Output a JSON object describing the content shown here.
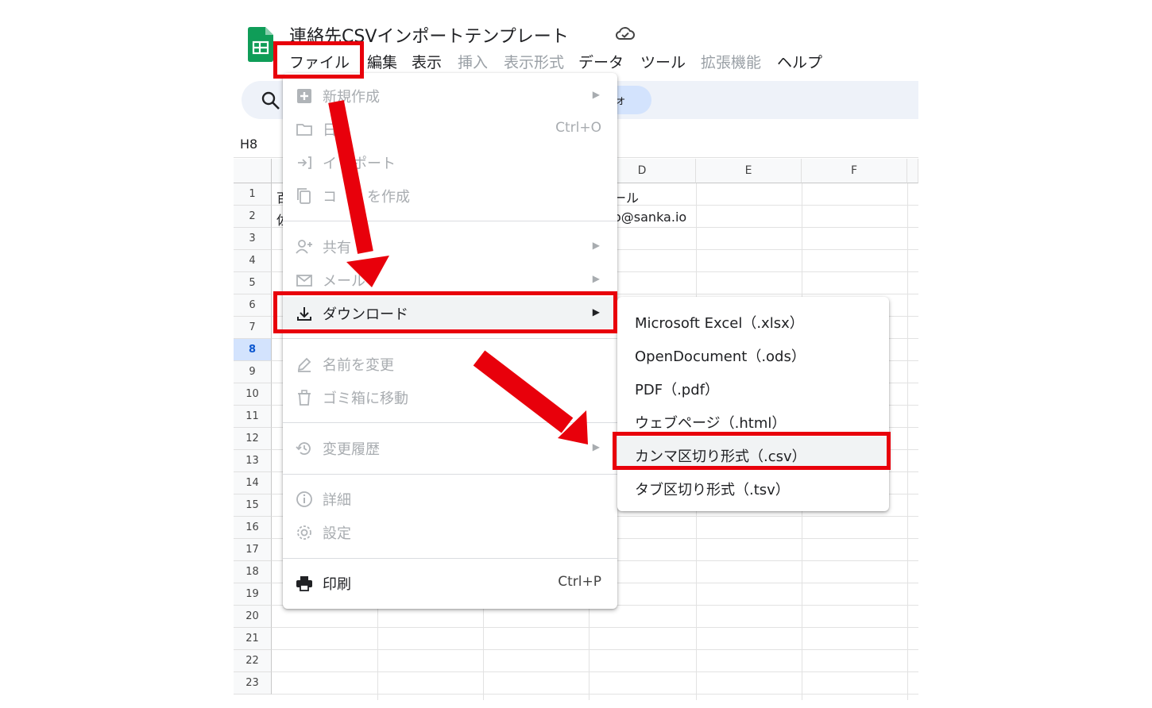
{
  "document": {
    "title": "連絡先CSVインポートテンプレート"
  },
  "menubar": [
    {
      "label": "ファイル",
      "disabled": false
    },
    {
      "label": "編集",
      "disabled": false
    },
    {
      "label": "表示",
      "disabled": false
    },
    {
      "label": "挿入",
      "disabled": true
    },
    {
      "label": "表示形式",
      "disabled": true
    },
    {
      "label": "データ",
      "disabled": false
    },
    {
      "label": "ツール",
      "disabled": false
    },
    {
      "label": "拡張機能",
      "disabled": true
    },
    {
      "label": "ヘルプ",
      "disabled": false
    }
  ],
  "name_box": "H8",
  "columns": [
    "D",
    "E",
    "F"
  ],
  "rows": [
    "1",
    "2",
    "3",
    "4",
    "5",
    "6",
    "7",
    "8",
    "9",
    "10",
    "11",
    "12",
    "13",
    "14",
    "15",
    "16",
    "17",
    "18",
    "19",
    "20",
    "21",
    "22",
    "23"
  ],
  "selected_row": "8",
  "cells": {
    "a1": "百",
    "a2": "佐",
    "d1": "ール",
    "d2": "o@sanka.io"
  },
  "file_menu": {
    "new": "新規作成",
    "open_fragment": "日",
    "open_shortcut": "Ctrl+O",
    "import_a": "イ",
    "import_b": "ポート",
    "copy_a": "コ",
    "copy_b": "を作成",
    "share": "共有",
    "email": "メール",
    "download": "ダウンロード",
    "rename": "名前を変更",
    "trash": "ゴミ箱に移動",
    "history": "変更履歴",
    "details": "詳細",
    "settings": "設定",
    "print": "印刷",
    "print_shortcut": "Ctrl+P",
    "arrow": "▶"
  },
  "toolbar_glyph": "ォ",
  "download_submenu": [
    "Microsoft Excel（.xlsx）",
    "OpenDocument（.ods）",
    "PDF（.pdf）",
    "ウェブページ（.html）",
    "カンマ区切り形式（.csv）",
    "タブ区切り形式（.tsv）"
  ],
  "colors": {
    "annotation": "#e8000b",
    "sheets_green": "#0f9d58",
    "selection": "#d3e3fd"
  }
}
